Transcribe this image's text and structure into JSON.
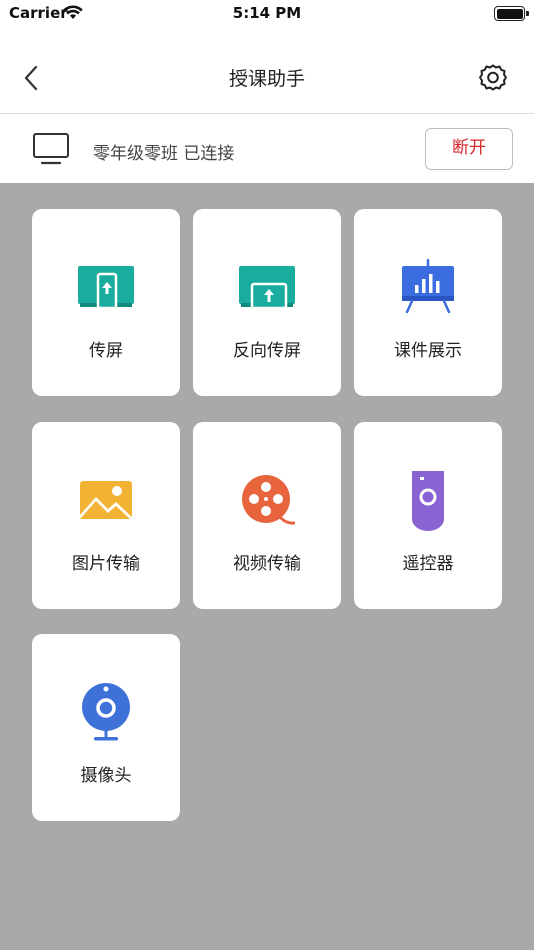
{
  "status_bar": {
    "carrier": "Carrier",
    "time": "5:14 PM"
  },
  "nav": {
    "title": "授课助手",
    "back_icon": "chevron-left-icon",
    "settings_icon": "gear-icon"
  },
  "connection": {
    "icon": "tv-icon",
    "status_text": "零年级零班 已连接",
    "disconnect_label": "断开",
    "accent": "#d7262a"
  },
  "tiles": [
    {
      "label": "传屏",
      "icon": "screen-cast-icon",
      "color": "#1aac9c"
    },
    {
      "label": "反向传屏",
      "icon": "reverse-cast-icon",
      "color": "#1aac9c"
    },
    {
      "label": "课件展示",
      "icon": "presentation-board-icon",
      "color": "#3c6de0"
    },
    {
      "label": "图片传输",
      "icon": "image-icon",
      "color": "#f2b233"
    },
    {
      "label": "视频传输",
      "icon": "film-reel-icon",
      "color": "#e8643c"
    },
    {
      "label": "遥控器",
      "icon": "remote-control-icon",
      "color": "#8a63d2"
    },
    {
      "label": "摄像头",
      "icon": "webcam-icon",
      "color": "#3f72d9"
    }
  ],
  "background_color": "#a9a9a9"
}
